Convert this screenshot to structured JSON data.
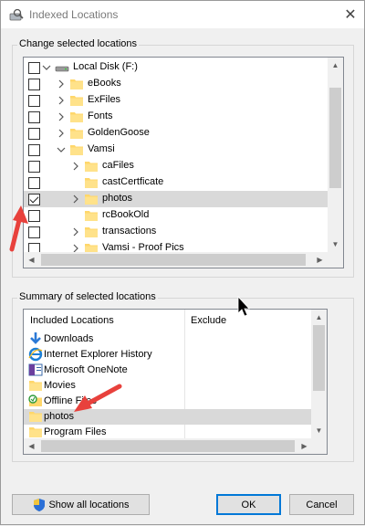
{
  "window": {
    "title": "Indexed Locations",
    "close_glyph": "✕"
  },
  "change_group": {
    "label": "Change selected locations",
    "items": [
      {
        "label": "Local Disk (F:)",
        "checked": false,
        "expanded": true,
        "level": 0,
        "icon": "drive-icon"
      },
      {
        "label": "eBooks",
        "checked": false,
        "expanded": false,
        "level": 1,
        "icon": "folder-icon"
      },
      {
        "label": "ExFiles",
        "checked": false,
        "expanded": false,
        "level": 1,
        "icon": "folder-icon"
      },
      {
        "label": "Fonts",
        "checked": false,
        "expanded": false,
        "level": 1,
        "icon": "folder-icon"
      },
      {
        "label": "GoldenGoose",
        "checked": false,
        "expanded": false,
        "level": 1,
        "icon": "folder-icon"
      },
      {
        "label": "Vamsi",
        "checked": false,
        "expanded": true,
        "level": 1,
        "icon": "folder-icon"
      },
      {
        "label": "caFiles",
        "checked": false,
        "expanded": false,
        "level": 2,
        "icon": "folder-icon"
      },
      {
        "label": "castCertficate",
        "checked": false,
        "expanded": null,
        "level": 2,
        "icon": "folder-icon"
      },
      {
        "label": "photos",
        "checked": true,
        "expanded": false,
        "level": 2,
        "icon": "folder-icon",
        "selected": true
      },
      {
        "label": "rcBookOld",
        "checked": false,
        "expanded": null,
        "level": 2,
        "icon": "folder-icon"
      },
      {
        "label": "transactions",
        "checked": false,
        "expanded": false,
        "level": 2,
        "icon": "folder-icon"
      },
      {
        "label": "Vamsi - Proof Pics",
        "checked": false,
        "expanded": false,
        "level": 2,
        "icon": "folder-icon"
      }
    ]
  },
  "summary_group": {
    "label": "Summary of selected locations",
    "columns": [
      "Included Locations",
      "Exclude"
    ],
    "items": [
      {
        "label": "Downloads",
        "icon": "download-arrow-icon"
      },
      {
        "label": "Internet Explorer History",
        "icon": "internet-explorer-icon"
      },
      {
        "label": "Microsoft OneNote",
        "icon": "onenote-icon"
      },
      {
        "label": "Movies",
        "icon": "folder-icon"
      },
      {
        "label": "Offline Files",
        "icon": "offline-files-icon"
      },
      {
        "label": "photos",
        "icon": "folder-icon",
        "selected": true
      },
      {
        "label": "Program Files",
        "icon": "folder-icon"
      }
    ]
  },
  "buttons": {
    "show_all": "Show all locations",
    "ok": "OK",
    "cancel": "Cancel"
  },
  "colors": {
    "annotation_arrow": "#e8413c",
    "selection": "#d9d9d9",
    "folder": "#ffd76b",
    "default_border": "#0078d7"
  }
}
